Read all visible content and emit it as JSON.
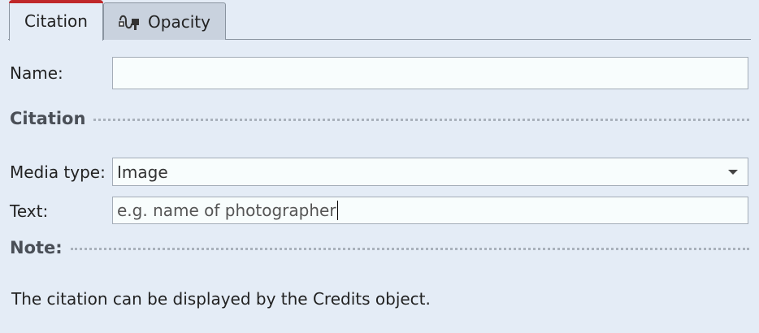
{
  "tabs": [
    {
      "label": "Citation",
      "active": true,
      "icon": ""
    },
    {
      "label": "Opacity",
      "active": false,
      "icon": "opacity-wave-icon"
    }
  ],
  "form": {
    "name_label": "Name:",
    "name_value": "",
    "citation_section": "Citation",
    "media_type_label": "Media type:",
    "media_type_value": "Image",
    "text_label": "Text:",
    "text_value": "e.g. name of photographer",
    "note_section": "Note:",
    "note_text": "The citation can be displayed by the Credits object."
  },
  "colors": {
    "background": "#e4ecf6",
    "active_tab_accent": "#c0282a",
    "inactive_tab": "#c9d2de",
    "field_background": "#f8fdfd"
  }
}
